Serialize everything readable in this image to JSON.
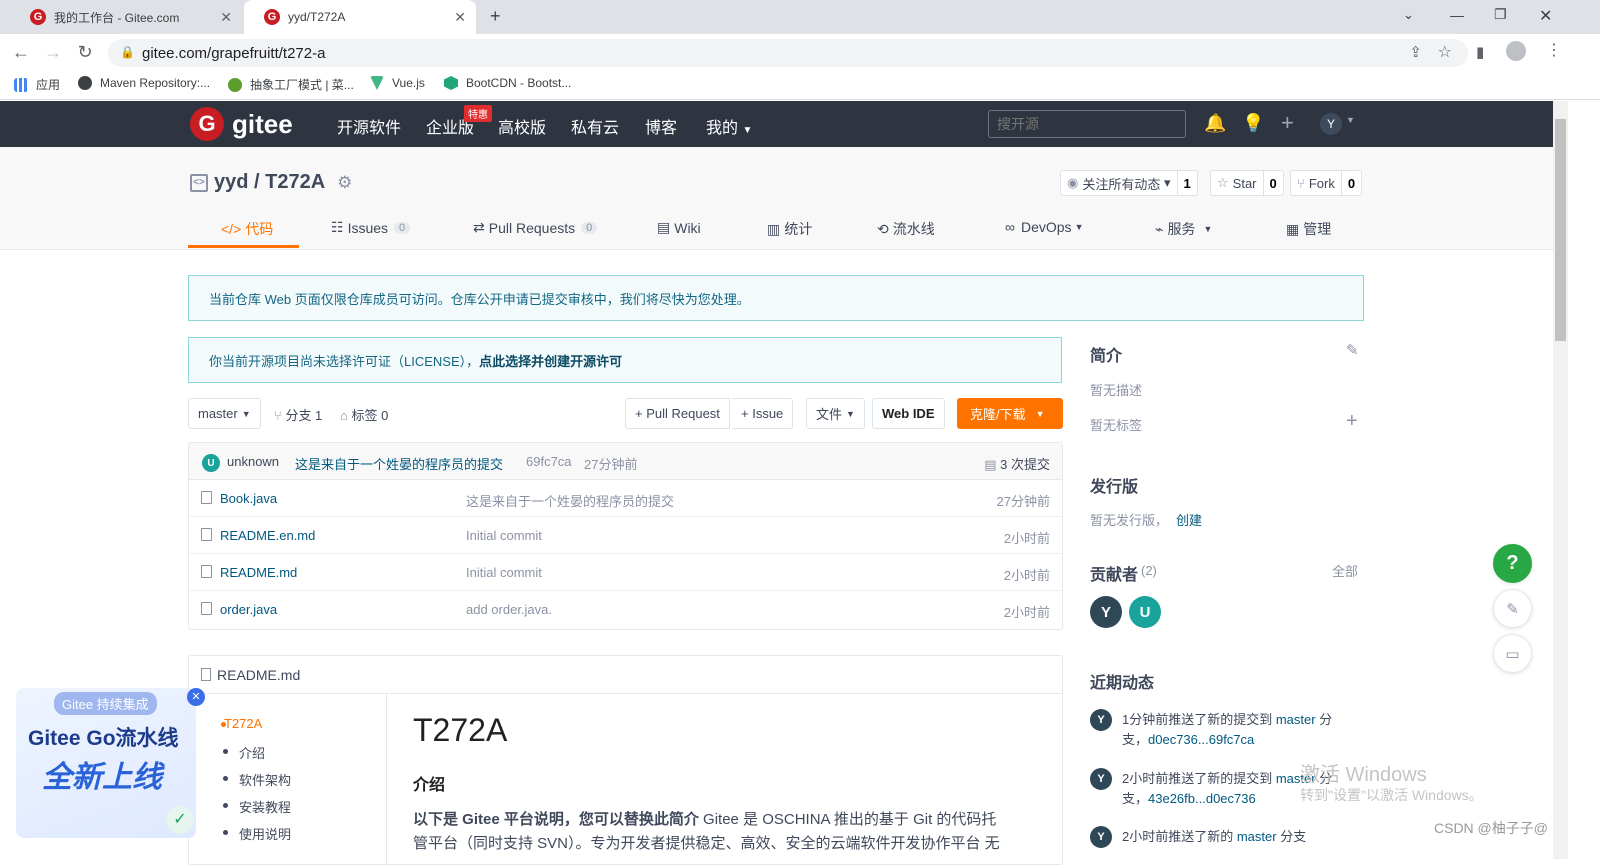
{
  "browser": {
    "tabs": [
      {
        "title": "我的工作台 - Gitee.com",
        "favicon": "G"
      },
      {
        "title": "yyd/T272A",
        "favicon": "G"
      }
    ],
    "new_tab": "+",
    "url": "gitee.com/grapefruitt/t272-a",
    "bookmarks": [
      {
        "label": "应用",
        "color": "#4285f4"
      },
      {
        "label": "Maven Repository:...",
        "color": "#3c4043"
      },
      {
        "label": "抽象工厂模式 | 菜...",
        "color": "#5b9e2c"
      },
      {
        "label": "Vue.js",
        "color": "#41b883"
      },
      {
        "label": "BootCDN - Bootst...",
        "color": "#1fa67a"
      }
    ]
  },
  "header": {
    "logo_text": "gitee",
    "logo_letter": "G",
    "nav": [
      "开源软件",
      "企业版",
      "高校版",
      "私有云",
      "博客",
      "我的"
    ],
    "hot_badge": "特惠",
    "search_placeholder": "搜开源",
    "avatar_letter": "Y"
  },
  "repo": {
    "title": "yyd / T272A",
    "watch_label": "关注所有动态",
    "watch_count": "1",
    "star_label": "Star",
    "star_count": "0",
    "fork_label": "Fork",
    "fork_count": "0",
    "tabs": [
      {
        "label": "代码",
        "icon": "code-icon"
      },
      {
        "label": "Issues",
        "count": "0"
      },
      {
        "label": "Pull Requests",
        "count": "0"
      },
      {
        "label": "Wiki"
      },
      {
        "label": "统计"
      },
      {
        "label": "流水线"
      },
      {
        "label": "DevOps"
      },
      {
        "label": "服务"
      },
      {
        "label": "管理"
      }
    ]
  },
  "notices": {
    "access": "当前仓库 Web 页面仅限仓库成员可访问。仓库公开申请已提交审核中，我们将尽快为您处理。",
    "license_text": "你当前开源项目尚未选择许可证（LICENSE），",
    "license_link": "点此选择并创建开源许可"
  },
  "toolbar": {
    "branch": "master",
    "branches": "分支 1",
    "tags": "标签 0",
    "pull_request": "+ Pull Request",
    "issue": "+ Issue",
    "file": "文件",
    "web_ide": "Web IDE",
    "clone": "克隆/下载"
  },
  "commit": {
    "avatar": "U",
    "author": "unknown",
    "message": "这是来自于一个姓晏的程序员的提交",
    "hash": "69fc7ca",
    "time": "27分钟前",
    "count": "3 次提交"
  },
  "files": [
    {
      "name": "Book.java",
      "message": "这是来自于一个姓晏的程序员的提交",
      "time": "27分钟前"
    },
    {
      "name": "README.en.md",
      "message": "Initial commit",
      "time": "2小时前"
    },
    {
      "name": "README.md",
      "message": "Initial commit",
      "time": "2小时前"
    },
    {
      "name": "order.java",
      "message": "add order.java.",
      "time": "2小时前"
    }
  ],
  "readme": {
    "filename": "README.md",
    "toc": [
      "T272A",
      "介绍",
      "软件架构",
      "安装教程",
      "使用说明"
    ],
    "title": "T272A",
    "section": "介绍",
    "intro_bold": "以下是 Gitee 平台说明，您可以替换此简介",
    "intro_rest": " Gitee 是 OSCHINA 推出的基于 Git 的代码托",
    "intro_line2": "管平台（同时支持 SVN）。专为开发者提供稳定、高效、安全的云端软件开发协作平台 无"
  },
  "sidebar": {
    "intro_title": "简介",
    "no_desc": "暂无描述",
    "no_tags": "暂无标签",
    "release_title": "发行版",
    "no_release": "暂无发行版，",
    "create": "创建",
    "contrib_title": "贡献者",
    "contrib_count": "(2)",
    "all": "全部",
    "contributors": [
      {
        "letter": "Y",
        "color": "#2f4858"
      },
      {
        "letter": "U",
        "color": "#1aa39a"
      }
    ],
    "activity_title": "近期动态",
    "events": [
      {
        "avatar": "Y",
        "text": "1分钟前推送了新的提交到 ",
        "branch": "master",
        "suffix": " 分支，",
        "link": "d0ec736...69fc7ca"
      },
      {
        "avatar": "Y",
        "text": "2小时前推送了新的提交到 ",
        "branch": "master",
        "suffix": " 分支，",
        "link": "43e26fb...d0ec736"
      },
      {
        "avatar": "Y",
        "text": "2小时前推送了新的 ",
        "branch": "master",
        "suffix": " 分支",
        "link": ""
      }
    ]
  },
  "floating": {
    "help": "?",
    "promo_tag": "Gitee 持续集成",
    "promo_title": "Gitee Go流水线",
    "promo_big": "全新上线"
  },
  "watermark": {
    "line1": "激活 Windows",
    "line2": "转到\"设置\"以激活 Windows。",
    "csdn": "CSDN @柚子子@"
  },
  "colors": {
    "brand": "#c71d23",
    "accent": "#fe7300",
    "link": "#005980",
    "header_bg": "#2e3440"
  }
}
